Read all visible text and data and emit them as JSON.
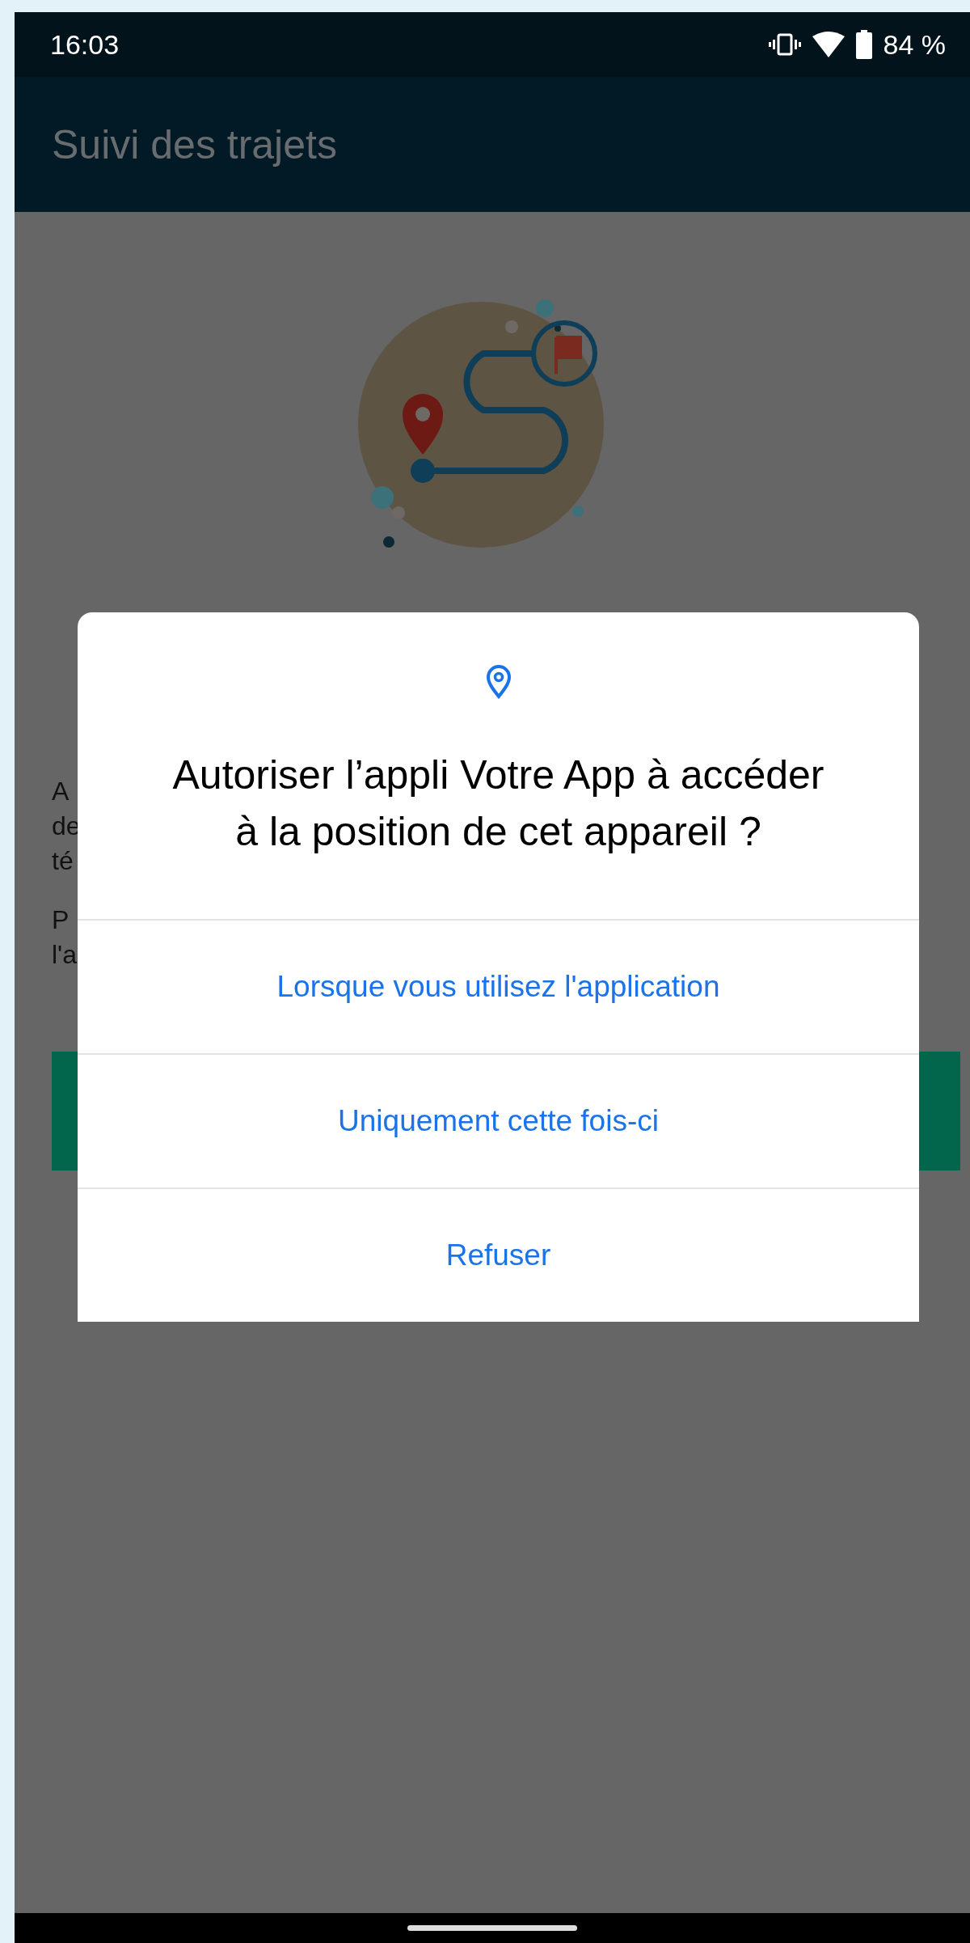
{
  "status_bar": {
    "time": "16:03",
    "battery": "84 %"
  },
  "app_bar": {
    "title": "Suivi des trajets"
  },
  "background_text": [
    {
      "lines": [
        "A",
        "de",
        "té"
      ]
    },
    {
      "lines": [
        "P",
        "l'a"
      ]
    }
  ],
  "dialog": {
    "title": "Autoriser l’appli Votre App à accéder à la position de cet appareil ?",
    "options": [
      "Lorsque vous utilisez l'application",
      "Uniquement cette fois-ci",
      "Refuser"
    ]
  }
}
